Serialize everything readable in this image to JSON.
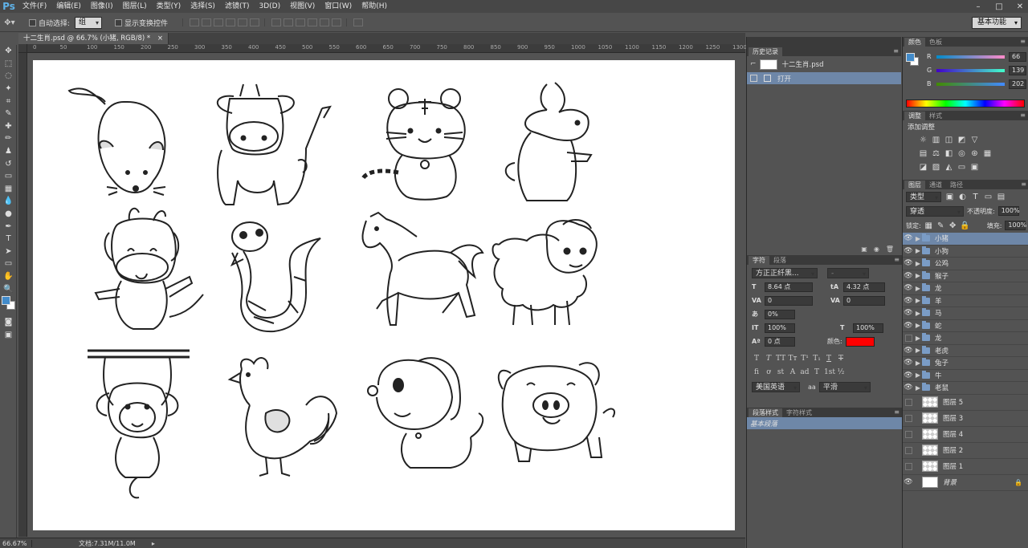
{
  "app": {
    "logo": "Ps"
  },
  "menu": [
    "文件(F)",
    "编辑(E)",
    "图像(I)",
    "图层(L)",
    "类型(Y)",
    "选择(S)",
    "滤镜(T)",
    "3D(D)",
    "视图(V)",
    "窗口(W)",
    "帮助(H)"
  ],
  "options": {
    "auto_select_label": "自动选择:",
    "auto_select_value": "组",
    "transform_label": "显示变换控件",
    "workspace": "基本功能"
  },
  "document": {
    "tab_title": "十二生肖.psd @ 66.7% (小猪, RGB/8) *",
    "tab_close": "×"
  },
  "ruler_ticks": [
    "0",
    "50",
    "100",
    "150",
    "200",
    "250",
    "300",
    "350",
    "400",
    "450",
    "500",
    "550",
    "600",
    "650",
    "700",
    "750",
    "800",
    "850",
    "900",
    "950",
    "1000",
    "1050",
    "1100",
    "1150",
    "1200",
    "1250",
    "1300"
  ],
  "status": {
    "zoom": "66.67%",
    "doc_info": "文档:7.31M/11.0M"
  },
  "history": {
    "tab": "历史记录",
    "snapshot": "十二生肖.psd",
    "open_step": "打开"
  },
  "color": {
    "tabs": [
      "颜色",
      "色板"
    ],
    "r_label": "R",
    "g_label": "G",
    "b_label": "B",
    "r": "66",
    "g": "139",
    "b": "202",
    "fg": "#428bca"
  },
  "adjust": {
    "tabs": [
      "调整",
      "样式"
    ],
    "title": "添加调整"
  },
  "character": {
    "tabs": [
      "字符",
      "段落"
    ],
    "font_family": "方正正纤黑...",
    "font_style": "-",
    "size": "8.64 点",
    "leading": "4.32 点",
    "kerning": "0",
    "tracking": "0",
    "baseline": "0%",
    "vscale": "100%",
    "hscale": "100%",
    "baseline_shift": "0 点",
    "color_label": "颜色:",
    "text_color": "#ff0000",
    "language": "美国英语",
    "aa_label": "aa",
    "antialias": "平滑"
  },
  "para_styles": {
    "tabs": [
      "段落样式",
      "字符样式"
    ],
    "base": "基本段落"
  },
  "layers": {
    "tabs": [
      "图层",
      "通道",
      "路径"
    ],
    "filter_kind": "类型",
    "blend": "穿透",
    "opacity_label": "不透明度:",
    "opacity": "100%",
    "lock_label": "锁定:",
    "fill_label": "填充:",
    "fill": "100%",
    "groups": [
      {
        "name": "小猪",
        "visible": true,
        "selected": true
      },
      {
        "name": "小狗",
        "visible": true
      },
      {
        "name": "公鸡",
        "visible": true
      },
      {
        "name": "猴子",
        "visible": true
      },
      {
        "name": "龙",
        "visible": true
      },
      {
        "name": "羊",
        "visible": true
      },
      {
        "name": "马",
        "visible": true
      },
      {
        "name": "蛇",
        "visible": true
      },
      {
        "name": "龙",
        "visible": false
      },
      {
        "name": "老虎",
        "visible": true
      },
      {
        "name": "兔子",
        "visible": true
      },
      {
        "name": "牛",
        "visible": true
      },
      {
        "name": "老鼠",
        "visible": true
      }
    ],
    "raster": [
      {
        "name": "图层 5",
        "visible": false
      },
      {
        "name": "图层 3",
        "visible": false
      },
      {
        "name": "图层 4",
        "visible": false
      },
      {
        "name": "图层 2",
        "visible": false
      },
      {
        "name": "图层 1",
        "visible": false
      }
    ],
    "background": "背景"
  }
}
